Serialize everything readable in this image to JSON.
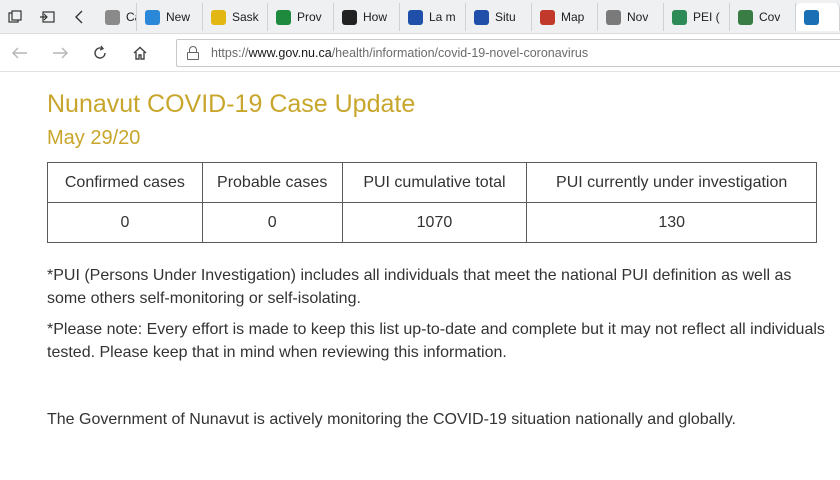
{
  "tabs": [
    {
      "label": "Case",
      "icon": "document-icon",
      "color": "#8a8a8a"
    },
    {
      "label": "New",
      "icon": "chart-icon",
      "color": "#2b88d8"
    },
    {
      "label": "Sask",
      "icon": "leaf-icon",
      "color": "#e2b714"
    },
    {
      "label": "Prov",
      "icon": "flag-icon",
      "color": "#1e8a3e"
    },
    {
      "label": "How",
      "icon": "shield-icon",
      "color": "#222222"
    },
    {
      "label": "La m",
      "icon": "fleur-de-lis-icon",
      "color": "#1f4fa8"
    },
    {
      "label": "Situ",
      "icon": "fleur-de-lis-icon",
      "color": "#1f4fa8"
    },
    {
      "label": "Map",
      "icon": "map-icon",
      "color": "#c0392b"
    },
    {
      "label": "Nov",
      "icon": "image-icon",
      "color": "#7a7a7a"
    },
    {
      "label": "PEI (",
      "icon": "tree-icon",
      "color": "#2e8b57"
    },
    {
      "label": "Cov",
      "icon": "globe-icon",
      "color": "#3a7d44"
    },
    {
      "label": "",
      "icon": "inukshuk-icon",
      "color": "#1a6fb5"
    }
  ],
  "address": {
    "protocol": "https://",
    "domain": "www.gov.nu.ca",
    "path": "/health/information/covid-19-novel-coronavirus"
  },
  "page": {
    "title": "Nunavut COVID-19 Case Update",
    "date": "May 29/20",
    "table": {
      "headers": [
        "Confirmed cases",
        "Probable cases",
        "PUI cumulative total",
        "PUI currently under investigation"
      ],
      "row": [
        "0",
        "0",
        "1070",
        "130"
      ]
    },
    "note1": "*PUI (Persons Under Investigation) includes all individuals that meet the national PUI definition as well as some others self-monitoring or self-isolating.",
    "note2": "*Please note: Every effort is made to keep this list up-to-date and complete but it may not reflect all individuals tested. Please keep that in mind when reviewing this information.",
    "para": "The Government of Nunavut is actively monitoring the COVID-19 situation nationally and globally."
  },
  "colors": {
    "heading": "#c8a62c",
    "text": "#333333"
  }
}
